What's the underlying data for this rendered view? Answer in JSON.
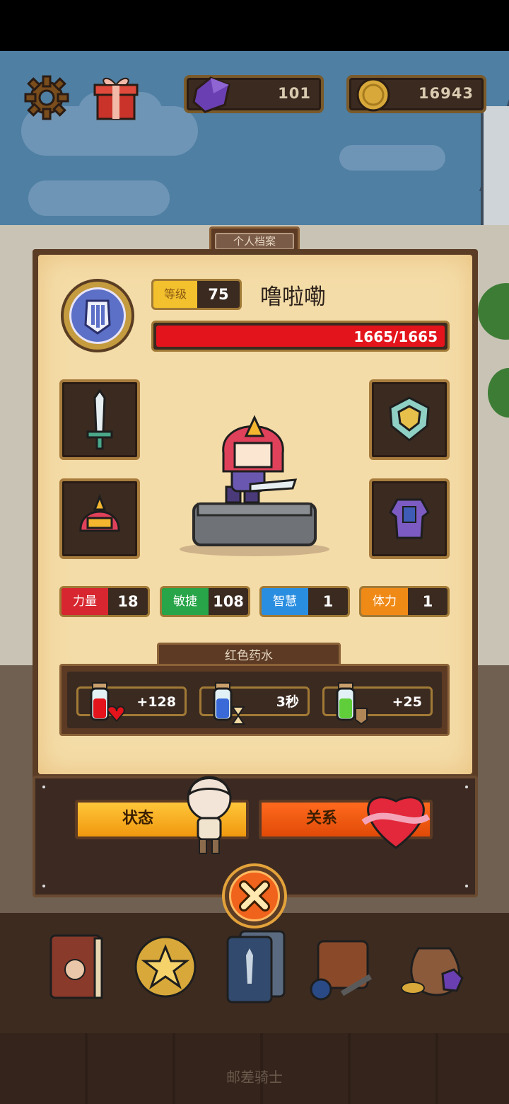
{
  "hud": {
    "gems": "101",
    "gold": "16943",
    "icons": [
      "gear-icon",
      "gift-icon",
      "gem-icon",
      "coin-icon"
    ]
  },
  "profile": {
    "tab_title": "个人档案",
    "level_label": "等级",
    "level_value": "75",
    "name": "噜啦嘞",
    "hp_text": "1665/1665",
    "hp_fraction": 1.0
  },
  "equipment": {
    "slots": [
      "sword",
      "shield",
      "helmet",
      "armor"
    ]
  },
  "stats": [
    {
      "label": "力量",
      "value": "18",
      "color": "#d7262f"
    },
    {
      "label": "敏捷",
      "value": "108",
      "color": "#27a548"
    },
    {
      "label": "智慧",
      "value": "1",
      "color": "#2a8ee0"
    },
    {
      "label": "体力",
      "value": "1",
      "color": "#f08a17"
    }
  ],
  "potions": {
    "title": "红色药水",
    "items": [
      {
        "value": "+128",
        "icon": "red-potion-icon"
      },
      {
        "value": "3秒",
        "icon": "blue-potion-icon"
      },
      {
        "value": "+25",
        "icon": "green-potion-icon"
      }
    ]
  },
  "buttons": {
    "status": "状态",
    "relation": "关系"
  },
  "bottom_nav": [
    "book-icon",
    "star-coin-icon",
    "card-icon",
    "bag-icon",
    "loot-icon"
  ],
  "footer_title": "邮差骑士",
  "colors": {
    "accent": "#f0631d",
    "gold_border": "#a17a36",
    "panel": "#f4dca8"
  }
}
